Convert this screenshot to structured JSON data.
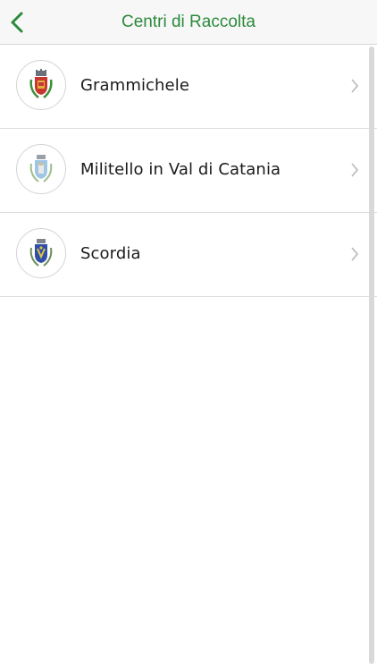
{
  "nav": {
    "title": "Centri di Raccolta",
    "back_icon": "chevron-left-icon"
  },
  "colors": {
    "accent": "#2c8a3c",
    "separator": "#dcdcdc"
  },
  "items": [
    {
      "label": "Grammichele",
      "icon": "coat-of-arms-grammichele"
    },
    {
      "label": "Militello in Val di Catania",
      "icon": "coat-of-arms-militello"
    },
    {
      "label": "Scordia",
      "icon": "coat-of-arms-scordia"
    }
  ]
}
